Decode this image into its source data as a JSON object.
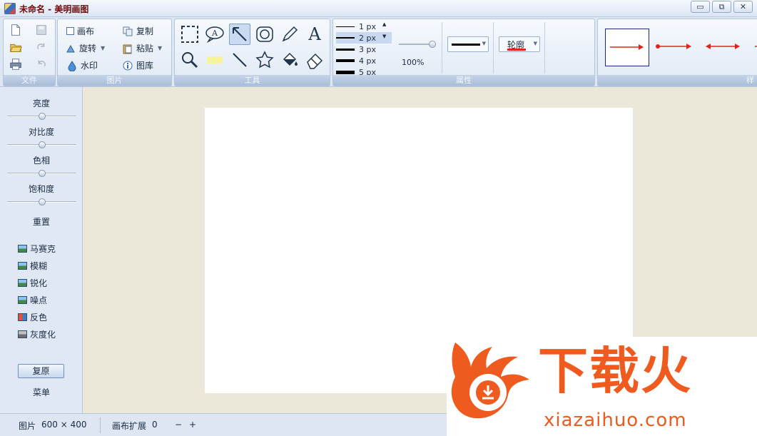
{
  "window": {
    "title": "未命名 - 美明画图",
    "minimize_glyph": "▭",
    "restore_glyph": "⧉",
    "close_glyph": "✕"
  },
  "ribbon": {
    "groups": {
      "file": "文件",
      "image": "图片",
      "tools": "工具",
      "properties": "属性",
      "styles": "样"
    },
    "image_items": {
      "canvas": "画布",
      "rotate": "旋转",
      "watermark": "水印",
      "copy": "复制",
      "paste": "粘贴",
      "gallery": "图库"
    },
    "text_tool_glyph": "A",
    "stroke_widths": [
      "1 px",
      "2 px",
      "3 px",
      "4 px",
      "5 px"
    ],
    "selected_stroke": "2 px",
    "opacity": "100%",
    "outline_label": "轮廓",
    "accent_red": "#e0241c"
  },
  "left_panel": {
    "adjustments": [
      "亮度",
      "对比度",
      "色相",
      "饱和度"
    ],
    "reset": "重置",
    "effects": [
      "马赛克",
      "模糊",
      "锐化",
      "噪点",
      "反色",
      "灰度化"
    ],
    "restore": "复原",
    "menu": "菜单"
  },
  "status_bar": {
    "image_label": "图片",
    "image_size": "600 × 400",
    "canvas_extend_label": "画布扩展",
    "canvas_extend_value": "0",
    "minus": "−",
    "plus": "+"
  },
  "watermark": {
    "brand_cn": "下载火",
    "brand_en": "xiazaihuo.com",
    "color": "#ef5a1e"
  }
}
